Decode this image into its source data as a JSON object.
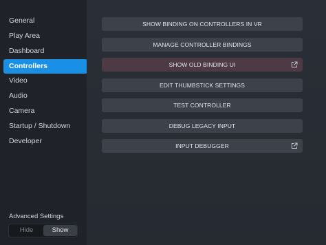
{
  "sidebar": {
    "items": [
      {
        "label": "General"
      },
      {
        "label": "Play Area"
      },
      {
        "label": "Dashboard"
      },
      {
        "label": "Controllers"
      },
      {
        "label": "Video"
      },
      {
        "label": "Audio"
      },
      {
        "label": "Camera"
      },
      {
        "label": "Startup / Shutdown"
      },
      {
        "label": "Developer"
      }
    ],
    "active": "Controllers",
    "advanced": {
      "label": "Advanced Settings",
      "hide_label": "Hide",
      "show_label": "Show",
      "selected": "Show"
    }
  },
  "main": {
    "buttons": [
      {
        "label": "SHOW BINDING ON CONTROLLERS IN VR"
      },
      {
        "label": "MANAGE CONTROLLER BINDINGS"
      },
      {
        "label": "SHOW OLD BINDING UI",
        "icon": "external-link-icon"
      },
      {
        "label": "EDIT THUMBSTICK SETTINGS"
      },
      {
        "label": "TEST CONTROLLER"
      },
      {
        "label": "DEBUG LEGACY INPUT"
      },
      {
        "label": "INPUT DEBUGGER",
        "icon": "external-link-icon"
      }
    ]
  },
  "colors": {
    "accent": "#1a8fe6",
    "sidebar_bg": "#1f2228",
    "content_bg": "#262a31",
    "button_bg": "#3c414a",
    "button_highlight_bg": "#4d3a45"
  }
}
